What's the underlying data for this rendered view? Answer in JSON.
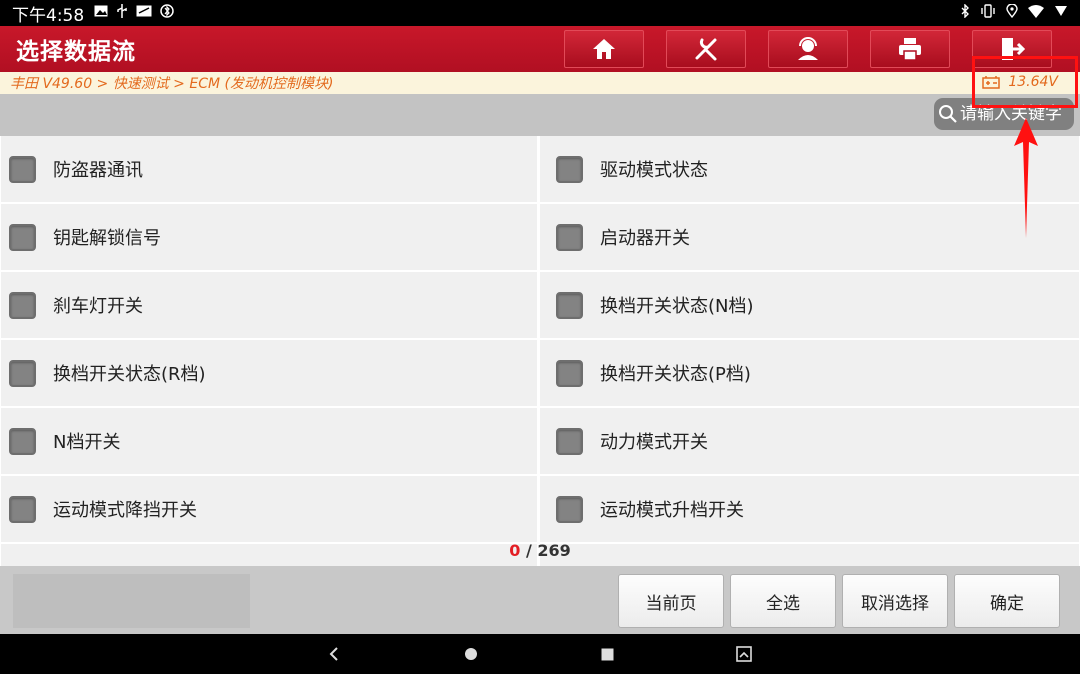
{
  "status_bar": {
    "time": "下午4:58",
    "left_icons": [
      "image-icon",
      "usb-icon",
      "notification-icon",
      "bluetooth-settings-icon"
    ],
    "right_icons": [
      "bluetooth-icon",
      "vibrate-icon",
      "location-icon",
      "wifi-icon",
      "battery-icon"
    ]
  },
  "header": {
    "title": "选择数据流",
    "buttons": [
      "home-icon",
      "diagnose-icon",
      "support-icon",
      "print-icon",
      "exit-icon"
    ]
  },
  "breadcrumb": "丰田 V49.60 > 快速测试 > ECM (发动机控制模块)",
  "battery_voltage": "13.64V",
  "search": {
    "placeholder": "请输入关键字"
  },
  "items": [
    {
      "label": "防盗器通讯",
      "checked": false
    },
    {
      "label": "驱动模式状态",
      "checked": false
    },
    {
      "label": "钥匙解锁信号",
      "checked": false
    },
    {
      "label": "启动器开关",
      "checked": false
    },
    {
      "label": "刹车灯开关",
      "checked": false
    },
    {
      "label": "换档开关状态(N档)",
      "checked": false
    },
    {
      "label": "换档开关状态(R档)",
      "checked": false
    },
    {
      "label": "换档开关状态(P档)",
      "checked": false
    },
    {
      "label": "N档开关",
      "checked": false
    },
    {
      "label": "动力模式开关",
      "checked": false
    },
    {
      "label": "运动模式降挡开关",
      "checked": false
    },
    {
      "label": "运动模式升档开关",
      "checked": false
    }
  ],
  "pager": {
    "selected": "0",
    "separator": " / ",
    "total": "269"
  },
  "bottom_buttons": {
    "current_page": "当前页",
    "select_all": "全选",
    "cancel_selection": "取消选择",
    "confirm": "确定"
  },
  "colors": {
    "brand": "#c8182a",
    "breadcrumb": "#e36a1e",
    "annotation": "#ff1111"
  }
}
